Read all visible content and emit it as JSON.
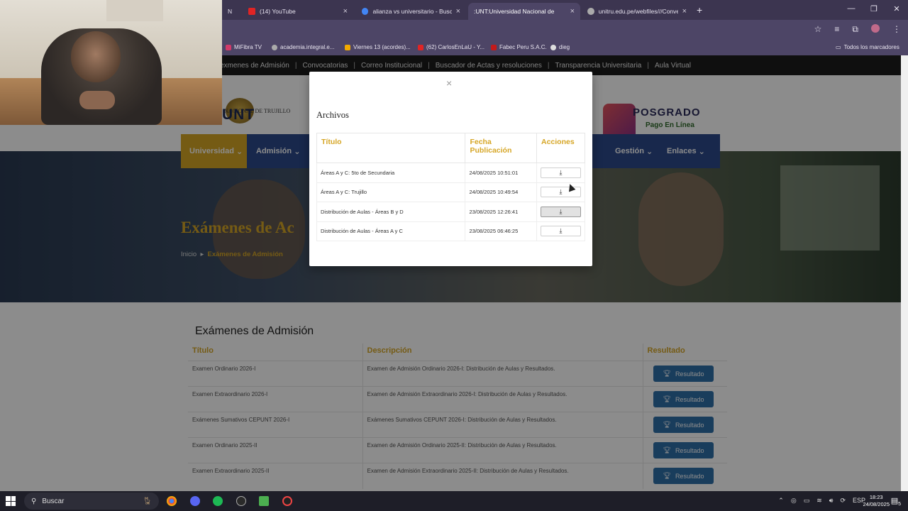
{
  "browser": {
    "tabs": [
      {
        "label": "(14) YouTube",
        "color": "#e02424"
      },
      {
        "label": "alianza vs universitario - Busca",
        "color": "#4285f4"
      },
      {
        "label": ":UNT:Universidad Nacional de",
        "color": "#bbbbbb"
      },
      {
        "label": "unitru.edu.pe/webfiles///Conve",
        "color": "#aaaaaa"
      }
    ],
    "first_tab_partial": "N",
    "bookmarks": [
      "MiFibra TV",
      "academia.integral.e...",
      "Viernes 13 (acordes)...",
      "(62) CarlosEnLaU - Y...",
      "Fabec Peru S.A.C.",
      "dieg"
    ],
    "all_bookmarks": "Todos los marcadores"
  },
  "site": {
    "topnav": [
      "exmenes de Admisión",
      "Convocatorias",
      "Correo Institucional",
      "Buscador de Actas y resoluciones",
      "Transparencia Universitaria",
      "Aula Virtual"
    ],
    "logo_sub": "NACIONAL DE TRUJILLO",
    "logo_text": "UNT",
    "posgrado_title": "POSGRADO",
    "posgrado_sub": "Pago En Línea",
    "mainnav": [
      "Universidad",
      "Admisión",
      "Gestión",
      "Enlaces"
    ],
    "hero_title": "Exámenes de Ac",
    "breadcrumb_home": "Inicio",
    "breadcrumb_current": "Exámenes de Admisión",
    "section_title": "Exámenes de Admisión",
    "exam_headers": [
      "Título",
      "Descripción",
      "Resultado"
    ],
    "exam_rows": [
      {
        "title": "Examen Ordinario 2026-I",
        "desc": "Examen de Admisión Ordinario 2026-I: Distribución de Aulas y Resultados."
      },
      {
        "title": "Examen Extraordinario 2026-I",
        "desc": "Examen de Admisión Extraordinario 2026-I: Distribución de Aulas y Resultados."
      },
      {
        "title": "Exámenes Sumativos CEPUNT 2026-I",
        "desc": "Exámenes Sumativos CEPUNT 2026-I: Distribución de Aulas y Resultados."
      },
      {
        "title": "Examen Ordinario 2025-II",
        "desc": "Examen de Admisión Ordinario 2025-II: Distribución de Aulas y Resultados."
      },
      {
        "title": "Examen Extraordinario 2025-II",
        "desc": "Examen de Admisión Extraordinario 2025-II: Distribución de Aulas y Resultados."
      }
    ],
    "result_button": "Resultado"
  },
  "modal": {
    "close": "×",
    "title": "Archivos",
    "headers": [
      "Título",
      "Fecha Publicación",
      "Acciones"
    ],
    "rows": [
      {
        "title": "Áreas A y C: 5to de Secundaria",
        "date": "24/08/2025 10:51:01"
      },
      {
        "title": "Áreas A y C: Trujillo",
        "date": "24/08/2025 10:49:54"
      },
      {
        "title": "Distribución de Aulas - Áreas B y D",
        "date": "23/08/2025 12:26:41"
      },
      {
        "title": "Distribución de Aulas - Áreas A y C",
        "date": "23/08/2025 06:46:25"
      }
    ],
    "download_icon": "⤓"
  },
  "taskbar": {
    "search_label": "Buscar",
    "lang": "ESP",
    "time": "18:23",
    "date": "24/08/2025",
    "notif_count": "5"
  }
}
